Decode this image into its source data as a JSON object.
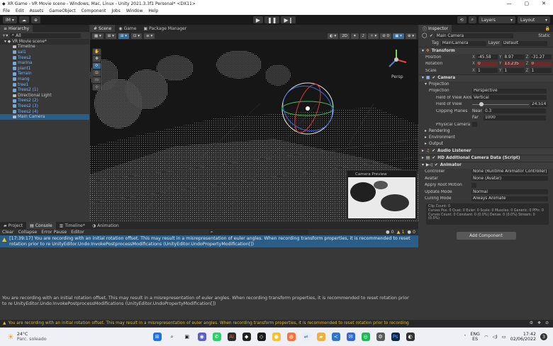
{
  "titlebar": {
    "title": "XR Game - VR Movie scene - Windows, Mac, Linux - Unity 2021.3.3f1 Personal* <DX11>",
    "minimize": "—",
    "maximize": "▢",
    "close": "✕"
  },
  "menu": [
    "File",
    "Edit",
    "Assets",
    "GameObject",
    "Component",
    "Jobs",
    "Window",
    "Help"
  ],
  "toolbar": {
    "account": "IM ▾",
    "layers": "Layers",
    "layout": "Layout"
  },
  "hierarchy": {
    "tab": "Hierarchy",
    "search_placeholder": "All",
    "scene": "VR Movie scene*",
    "items": [
      {
        "label": "Timeline",
        "blue": false
      },
      {
        "label": "sal1",
        "blue": true
      },
      {
        "label": "Trees2",
        "blue": true
      },
      {
        "label": "marina",
        "blue": true
      },
      {
        "label": "plant1",
        "blue": true
      },
      {
        "label": "Terrain",
        "blue": true
      },
      {
        "label": "mang",
        "blue": true
      },
      {
        "label": "tree1",
        "blue": true
      },
      {
        "label": "Trees2 (1)",
        "blue": true
      },
      {
        "label": "Directional Light",
        "blue": false
      },
      {
        "label": "Trees2 (2)",
        "blue": true
      },
      {
        "label": "Trees2 (3)",
        "blue": true
      },
      {
        "label": "Trees2 (4)",
        "blue": true
      },
      {
        "label": "Main Camera",
        "blue": false
      }
    ]
  },
  "scene": {
    "tabs": [
      "Scene",
      "Game",
      "Package Manager"
    ],
    "persp": "Persp",
    "camera_preview": "Camera Preview"
  },
  "console": {
    "tabs": [
      "Project",
      "Console",
      "Timeline*",
      "Animation"
    ],
    "toolbar": [
      "Clear",
      "Collapse",
      "Error Pause",
      "Editor"
    ],
    "counts": {
      "info": "0",
      "warn": "1",
      "error": "0"
    },
    "entry": "[17:39:17] You are recording with an initial rotation offset. This may result in a misrepresentation of euler angles. When recording transform properties, it is recommended to reset rotation prior to re UnityEditor.Undo:InvokePostprocessModifications (UnityEditor.UndoPropertyModification[])",
    "detail": "You are recording with an initial rotation offset. This may result in a misrepresentation of euler angles. When recording transform properties, it is recommended to reset rotation prior to re UnityEditor.Undo:InvokePostprocessModifications (UnityEditor.UndoPropertyModification[])"
  },
  "inspector": {
    "tab": "Inspector",
    "object_name": "Main Camera",
    "static": "Static",
    "tag_label": "Tag",
    "tag": "MainCamera",
    "layer_label": "Layer",
    "layer": "Default",
    "transform": {
      "title": "Transform",
      "position": {
        "label": "Position",
        "x": "-45.58",
        "y": "8.97",
        "z": "-31.27"
      },
      "rotation": {
        "label": "Rotation",
        "x": "0",
        "y": "13.235",
        "z": "0"
      },
      "scale": {
        "label": "Scale",
        "x": "1",
        "y": "1",
        "z": "1"
      }
    },
    "camera": {
      "title": "Camera",
      "projection_section": "Projection",
      "projection_label": "Projection",
      "projection": "Perspective",
      "fov_axis_label": "Field of View Axis",
      "fov_axis": "Vertical",
      "fov_label": "Field of View",
      "fov": "24.514",
      "clipping_label": "Clipping Planes",
      "near_label": "Near",
      "near": "0.3",
      "far_label": "Far",
      "far": "1000",
      "physical": "Physical Camera",
      "rendering": "Rendering",
      "environment": "Environment",
      "output": "Output"
    },
    "audio_listener": "Audio Listener",
    "hd_camera": "HD Additional Camera Data (Script)",
    "animator": {
      "title": "Animator",
      "controller_label": "Controller",
      "controller": "None (Runtime Animator Controller)",
      "avatar_label": "Avatar",
      "avatar": "None (Avatar)",
      "root_motion": "Apply Root Motion",
      "update_label": "Update Mode",
      "update": "Normal",
      "culling_label": "Culling Mode",
      "culling": "Always Animate",
      "info": "Clip Count: 0\nCurves Pos: 0 Quat: 0 Euler: 0 Scale: 0 Muscles: 0 Generic: 0 PPtr: 0\nCurves Count: 0 Constant: 0 (0.0%) Dense: 0 (0.0%) Stream: 0 (0.0%)"
    },
    "add_component": "Add Component"
  },
  "warnbar": "You are recording with an initial rotation offset. This may result in a misrepresentation of euler angles. When recording transform properties, it is recommended to reset rotation prior to recording",
  "taskbar": {
    "weather_temp": "24°C",
    "weather_desc": "Parc. soleado",
    "lang": "ENG",
    "lang2": "ES",
    "time": "17:42",
    "date": "02/06/2022"
  },
  "colors": {
    "accent_blue": "#2c5d87",
    "warn_yellow": "#e4c34a"
  }
}
